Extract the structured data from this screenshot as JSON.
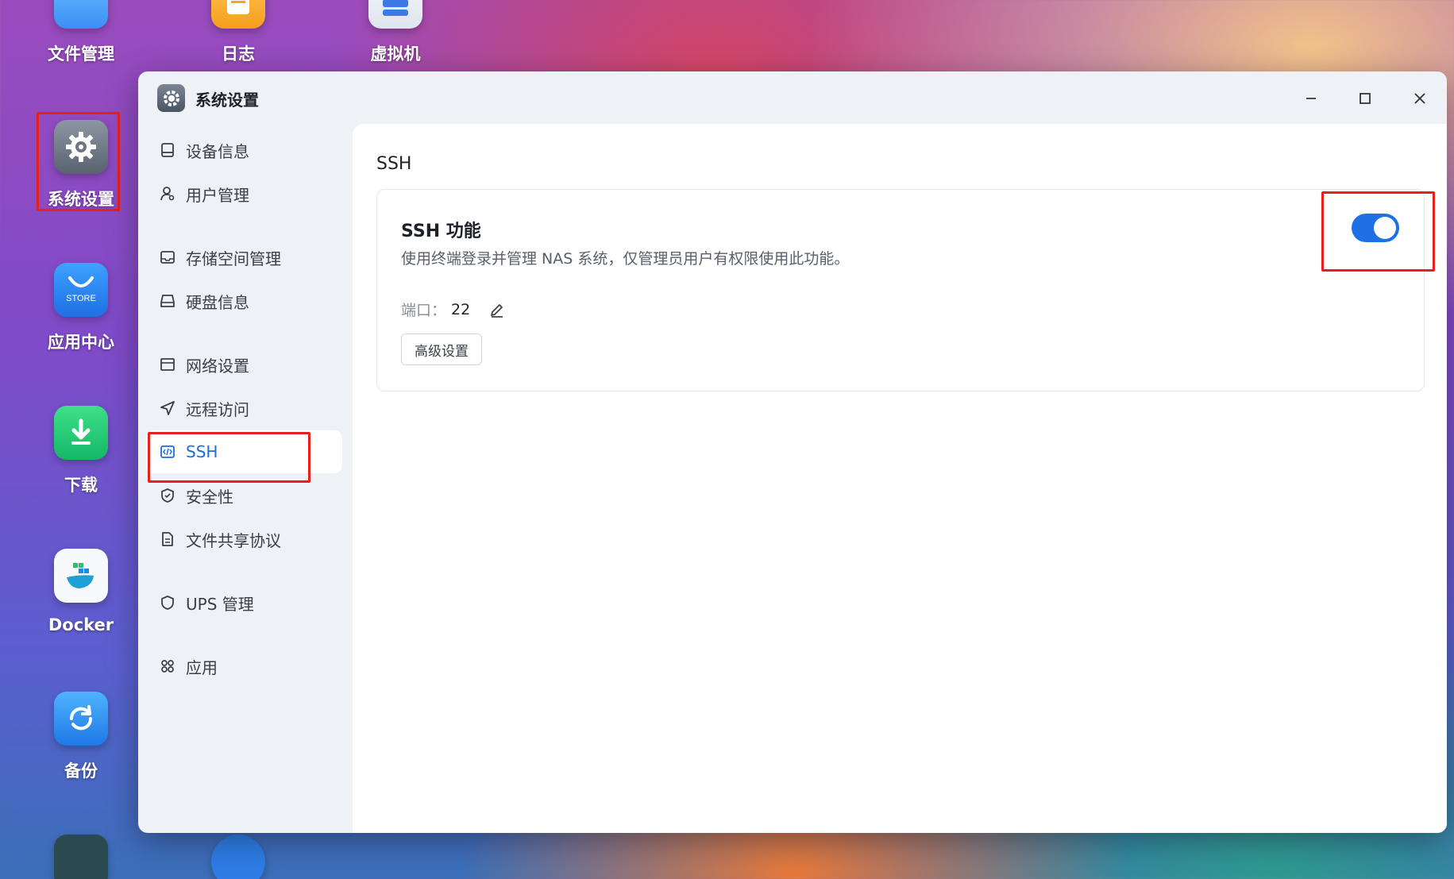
{
  "desktop": {
    "icons": [
      {
        "label": "文件管理"
      },
      {
        "label": "日志"
      },
      {
        "label": "虚拟机"
      },
      {
        "label": "系统设置"
      },
      {
        "label": "应用中心",
        "badge": "STORE"
      },
      {
        "label": "下载"
      },
      {
        "label": "Docker"
      },
      {
        "label": "备份"
      }
    ]
  },
  "window": {
    "title": "系统设置",
    "controls": {
      "minimize": "minimize-icon",
      "maximize": "maximize-icon",
      "close": "close-icon"
    }
  },
  "sidebar": {
    "items": [
      {
        "label": "设备信息",
        "icon": "device-info-icon"
      },
      {
        "label": "用户管理",
        "icon": "user-manage-icon"
      },
      {
        "label": "存储空间管理",
        "icon": "storage-icon"
      },
      {
        "label": "硬盘信息",
        "icon": "disk-icon"
      },
      {
        "label": "网络设置",
        "icon": "network-icon"
      },
      {
        "label": "远程访问",
        "icon": "remote-access-icon"
      },
      {
        "label": "SSH",
        "icon": "code-icon",
        "active": true
      },
      {
        "label": "安全性",
        "icon": "shield-check-icon"
      },
      {
        "label": "文件共享协议",
        "icon": "document-icon"
      },
      {
        "label": "UPS 管理",
        "icon": "shield-icon"
      },
      {
        "label": "应用",
        "icon": "apps-grid-icon"
      }
    ]
  },
  "main": {
    "section_title": "SSH",
    "card": {
      "title": "SSH 功能",
      "description": "使用终端登录并管理 NAS 系统，仅管理员用户有权限使用此功能。",
      "port_label": "端口：",
      "port_value": "22",
      "advanced_button": "高级设置",
      "enabled": true
    }
  },
  "colors": {
    "accent": "#1f6fe5",
    "highlight": "#e8201c"
  }
}
